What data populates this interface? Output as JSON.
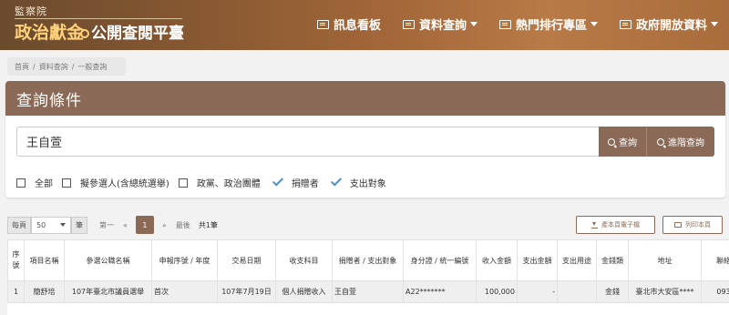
{
  "header": {
    "logo_top": "監察院",
    "logo_highlight": "政治獻金",
    "logo_rest": "公開查閱平臺",
    "nav": [
      {
        "label": "訊息看板",
        "has_caret": false
      },
      {
        "label": "資料查詢",
        "has_caret": true
      },
      {
        "label": "熱門排行專區",
        "has_caret": true
      },
      {
        "label": "政府開放資料",
        "has_caret": true
      }
    ]
  },
  "breadcrumb": [
    "首頁",
    "/",
    "資料查詢",
    "/",
    "一般查詢"
  ],
  "query": {
    "title": "查詢條件",
    "search_value": "王自萱",
    "search_button": "查詢",
    "advanced_button": "進階查詢",
    "filters": [
      {
        "label": "全部",
        "checked": false
      },
      {
        "label": "擬參選人(含總統選舉)",
        "checked": false
      },
      {
        "label": "政黨、政治團體",
        "checked": false
      },
      {
        "label": "捐贈者",
        "checked": true
      },
      {
        "label": "支出對象",
        "checked": true
      }
    ]
  },
  "pager": {
    "per_page_label": "每頁",
    "per_page_value": "50",
    "per_page_unit": "筆",
    "first": "第一",
    "prev": "«",
    "current": "1",
    "next": "»",
    "last": "最後",
    "total": "共1筆"
  },
  "actions": {
    "export_label": "產本頁電子檔",
    "print_label": "列印本頁"
  },
  "table": {
    "headers": [
      "序號",
      "項目名稱",
      "參選公職名稱",
      "申報序號 / 年度",
      "交易日期",
      "收支科目",
      "捐贈者 / 支出對象",
      "身分證 / 統一編號",
      "收入金額",
      "支出金額",
      "支出用途",
      "金錢類",
      "地址",
      "聯絡"
    ],
    "rows": [
      [
        "1",
        "簡舒培",
        "107年臺北市議員選舉",
        "首次",
        "107年7月19日",
        "個人捐贈收入",
        "王自萱",
        "A22*******",
        "100,000",
        "-",
        "",
        "金錢",
        "臺北市大安區****",
        "093"
      ]
    ]
  }
}
